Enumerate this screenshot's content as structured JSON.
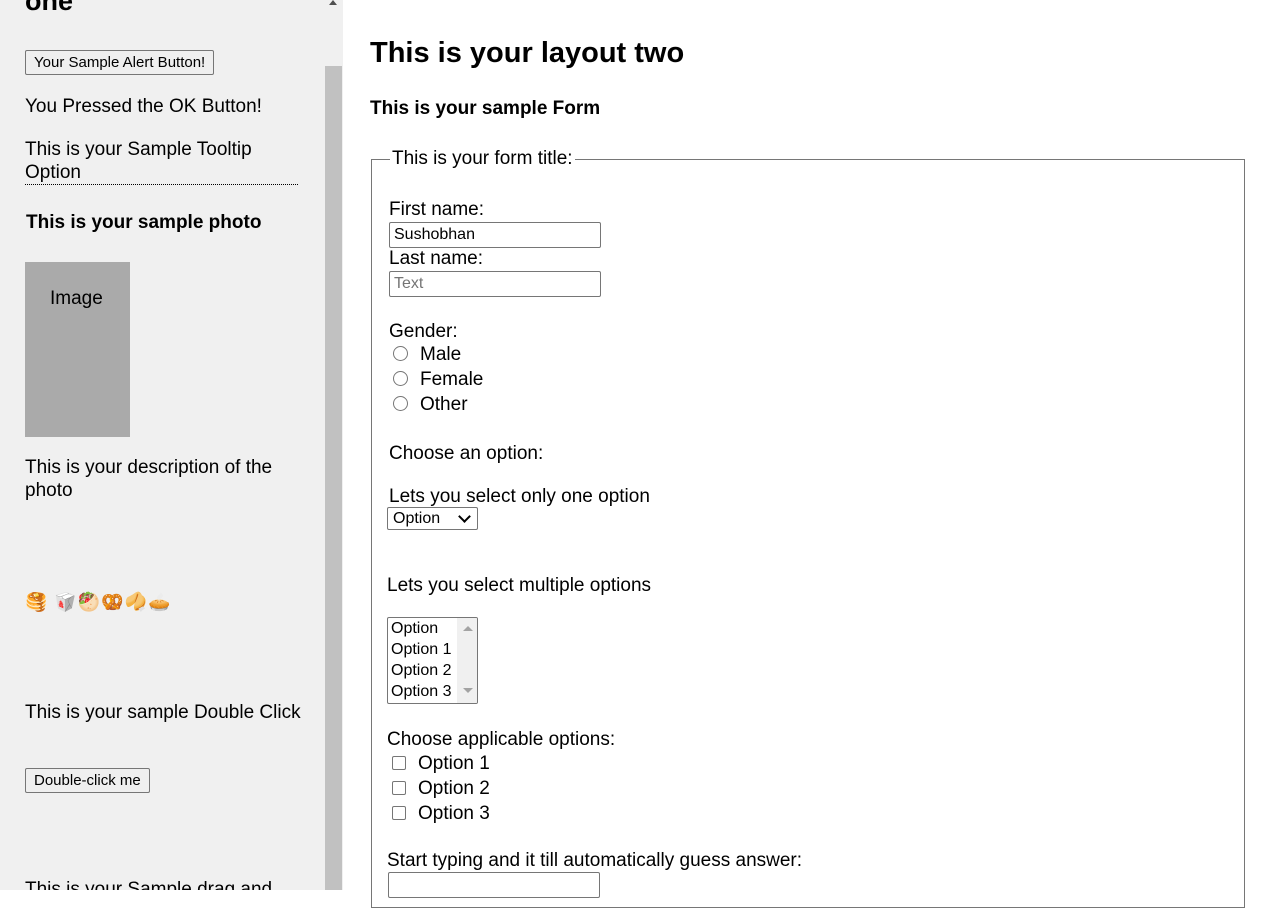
{
  "left": {
    "title": "one",
    "alert_button": "Your Sample Alert Button!",
    "pressed_text": "You Pressed the OK Button!",
    "tooltip_text": "This is your Sample Tooltip Option",
    "photo_heading": "This is your sample photo",
    "photo_placeholder": "Image",
    "photo_description": "This is your description of the photo",
    "emojis": "🥞 🥡🥙🥨🥠🥧",
    "double_click_heading": "This is your sample Double Click",
    "double_click_button": "Double-click me",
    "drag_heading": "This is your Sample drag and"
  },
  "right": {
    "title": "This is your layout two",
    "form_heading": "This is your sample Form",
    "form": {
      "legend": "This is your form title:",
      "first_name_label": "First name:",
      "first_name_value": "Sushobhan",
      "last_name_label": "Last name:",
      "last_name_placeholder": "Text",
      "gender_label": "Gender:",
      "gender_options": [
        "Male",
        "Female",
        "Other"
      ],
      "choose_option_label": "Choose an option:",
      "single_select_label": "Lets you select only one option",
      "single_select_value": "Option",
      "multi_select_label": "Lets you select multiple options",
      "multi_select_options": [
        "Option",
        "Option 1",
        "Option 2",
        "Option 3"
      ],
      "checkbox_label": "Choose applicable options:",
      "checkbox_options": [
        "Option 1",
        "Option 2",
        "Option 3"
      ],
      "autocomplete_label": "Start typing and it till automatically guess answer:"
    }
  }
}
